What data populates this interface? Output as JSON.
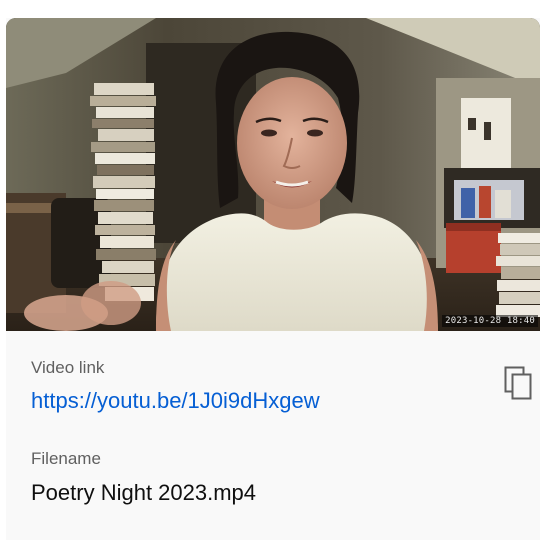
{
  "video": {
    "timestamp": "2023-10-28 18:40"
  },
  "details": {
    "link_label": "Video link",
    "link_url": "https://youtu.be/1J0i9dHxgew",
    "filename_label": "Filename",
    "filename": "Poetry Night 2023.mp4"
  },
  "icons": {
    "copy": "copy-icon"
  },
  "colors": {
    "link": "#065fd4",
    "label": "#606060",
    "text": "#0f0f0f",
    "panel_bg": "#f9f9f9"
  }
}
